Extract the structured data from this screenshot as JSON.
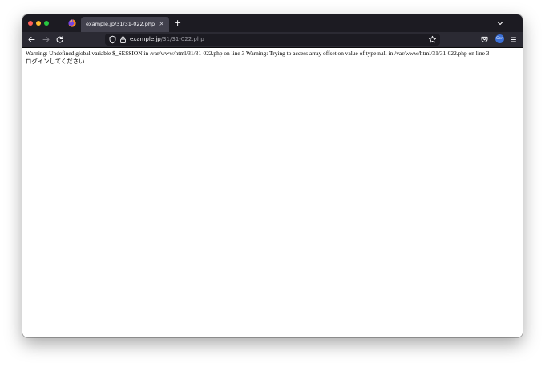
{
  "browser": {
    "tab": {
      "title": "example.jp/31/31-022.php",
      "close_glyph": "×"
    },
    "new_tab_glyph": "+",
    "url": {
      "host": "example.jp",
      "path": "/31/31-022.php"
    },
    "profile_badge": "Gen",
    "icons": {
      "back": "back-arrow-icon",
      "forward": "forward-arrow-icon",
      "reload": "reload-icon",
      "tracking": "shield-icon",
      "lock": "lock-icon",
      "bookmark": "star-icon",
      "pocket": "pocket-icon",
      "menu": "hamburger-menu-icon",
      "tab_list": "chevron-down-icon"
    },
    "colors": {
      "titlebar": "#1c1b22",
      "tab": "#42414d",
      "toolbar": "#2b2a33",
      "urlbar": "#1c1b22"
    }
  },
  "page": {
    "warning_text": "Warning: Undefined global variable $_SESSION in /var/www/html/31/31-022.php on line 3 Warning: Trying to access array offset on value of type null in /var/www/html/31/31-022.php on line 3",
    "message": "ログインしてください"
  }
}
